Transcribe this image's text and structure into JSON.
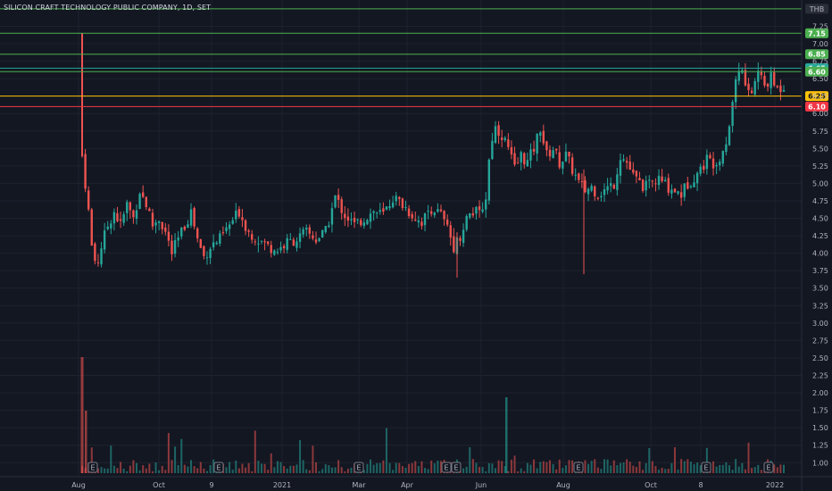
{
  "header": {
    "title": "SILICON CRAFT TECHNOLOGY PUBLIC COMPANY, 1D, SET"
  },
  "chart_data": {
    "type": "candlestick",
    "currency_label": "THB",
    "colors": {
      "up": "#26a69a",
      "down": "#ef5350",
      "background": "#131722",
      "grid": "#1e222d",
      "axis_text": "#b2b5be"
    },
    "y_ticks": [
      "7.25",
      "7.00",
      "6.75",
      "6.50",
      "6.25",
      "6.00",
      "5.75",
      "5.50",
      "5.25",
      "5.00",
      "4.75",
      "4.50",
      "4.25",
      "4.00",
      "3.75",
      "3.50",
      "3.25",
      "3.00",
      "2.75",
      "2.50",
      "2.25",
      "2.00",
      "1.75",
      "1.50",
      "1.25",
      "1.00"
    ],
    "x_ticks": [
      "Aug",
      "Oct",
      "9",
      "2021",
      "Mar",
      "Apr",
      "Jun",
      "Aug",
      "Oct",
      "8",
      "2022"
    ],
    "ylim": [
      0.85,
      7.55
    ],
    "levels": [
      {
        "value": 7.5,
        "color": "#4caf50",
        "label": ""
      },
      {
        "value": 7.15,
        "color": "#4caf50",
        "label": "7.15"
      },
      {
        "value": 6.85,
        "color": "#4caf50",
        "label": "6.85"
      },
      {
        "value": 6.65,
        "color": "#26a69a",
        "label": "6.65"
      },
      {
        "value": 6.6,
        "color": "#4caf50",
        "label": "6.60"
      },
      {
        "value": 6.25,
        "color": "#ffc107",
        "label": "6.25"
      },
      {
        "value": 6.1,
        "color": "#f23645",
        "label": "6.10"
      }
    ],
    "earnings_markers": [
      "E",
      "E",
      "E",
      "E",
      "E",
      "E",
      "E",
      "E"
    ],
    "close_path": [
      [
        0,
        5.4
      ],
      [
        2,
        5.0
      ],
      [
        4,
        4.6
      ],
      [
        6,
        4.1
      ],
      [
        9,
        3.8
      ],
      [
        12,
        4.1
      ],
      [
        16,
        4.4
      ],
      [
        20,
        4.6
      ],
      [
        24,
        4.4
      ],
      [
        28,
        4.7
      ],
      [
        32,
        4.5
      ],
      [
        36,
        4.9
      ],
      [
        40,
        4.7
      ],
      [
        44,
        4.4
      ],
      [
        48,
        4.5
      ],
      [
        52,
        4.3
      ],
      [
        56,
        4.0
      ],
      [
        60,
        4.2
      ],
      [
        64,
        4.4
      ],
      [
        68,
        4.6
      ],
      [
        72,
        4.2
      ],
      [
        76,
        3.95
      ],
      [
        80,
        4.1
      ],
      [
        86,
        4.2
      ],
      [
        92,
        4.4
      ],
      [
        98,
        4.6
      ],
      [
        104,
        4.3
      ],
      [
        110,
        4.2
      ],
      [
        116,
        4.1
      ],
      [
        122,
        4.05
      ],
      [
        128,
        4.15
      ],
      [
        134,
        4.2
      ],
      [
        140,
        4.3
      ],
      [
        146,
        4.2
      ],
      [
        152,
        4.3
      ],
      [
        158,
        4.8
      ],
      [
        164,
        4.55
      ],
      [
        170,
        4.4
      ],
      [
        176,
        4.5
      ],
      [
        182,
        4.6
      ],
      [
        188,
        4.55
      ],
      [
        194,
        4.8
      ],
      [
        200,
        4.7
      ],
      [
        206,
        4.55
      ],
      [
        212,
        4.45
      ],
      [
        218,
        4.65
      ],
      [
        224,
        4.55
      ],
      [
        228,
        4.35
      ],
      [
        232,
        4.1
      ],
      [
        236,
        4.25
      ],
      [
        240,
        4.5
      ],
      [
        244,
        4.6
      ],
      [
        248,
        4.55
      ],
      [
        252,
        4.8
      ],
      [
        255,
        5.6
      ],
      [
        258,
        5.8
      ],
      [
        262,
        5.7
      ],
      [
        266,
        5.5
      ],
      [
        270,
        5.2
      ],
      [
        274,
        5.4
      ],
      [
        278,
        5.3
      ],
      [
        282,
        5.5
      ],
      [
        286,
        5.8
      ],
      [
        290,
        5.4
      ],
      [
        294,
        5.5
      ],
      [
        298,
        5.3
      ],
      [
        302,
        5.4
      ],
      [
        306,
        5.2
      ],
      [
        310,
        5.0
      ],
      [
        314,
        4.9
      ],
      [
        318,
        4.95
      ],
      [
        322,
        4.85
      ],
      [
        326,
        4.9
      ],
      [
        332,
        5.0
      ],
      [
        336,
        5.4
      ],
      [
        340,
        5.3
      ],
      [
        344,
        5.1
      ],
      [
        348,
        5.0
      ],
      [
        352,
        4.95
      ],
      [
        356,
        5.0
      ],
      [
        360,
        5.05
      ],
      [
        366,
        4.95
      ],
      [
        370,
        4.9
      ],
      [
        374,
        4.85
      ],
      [
        378,
        5.0
      ],
      [
        382,
        5.1
      ],
      [
        386,
        5.2
      ],
      [
        390,
        5.35
      ],
      [
        394,
        5.3
      ],
      [
        398,
        5.4
      ],
      [
        402,
        5.6
      ],
      [
        405,
        6.0
      ],
      [
        408,
        6.5
      ],
      [
        411,
        6.7
      ],
      [
        414,
        6.4
      ],
      [
        418,
        6.3
      ],
      [
        422,
        6.6
      ],
      [
        426,
        6.4
      ],
      [
        430,
        6.5
      ],
      [
        434,
        6.35
      ],
      [
        438,
        6.4
      ]
    ]
  }
}
